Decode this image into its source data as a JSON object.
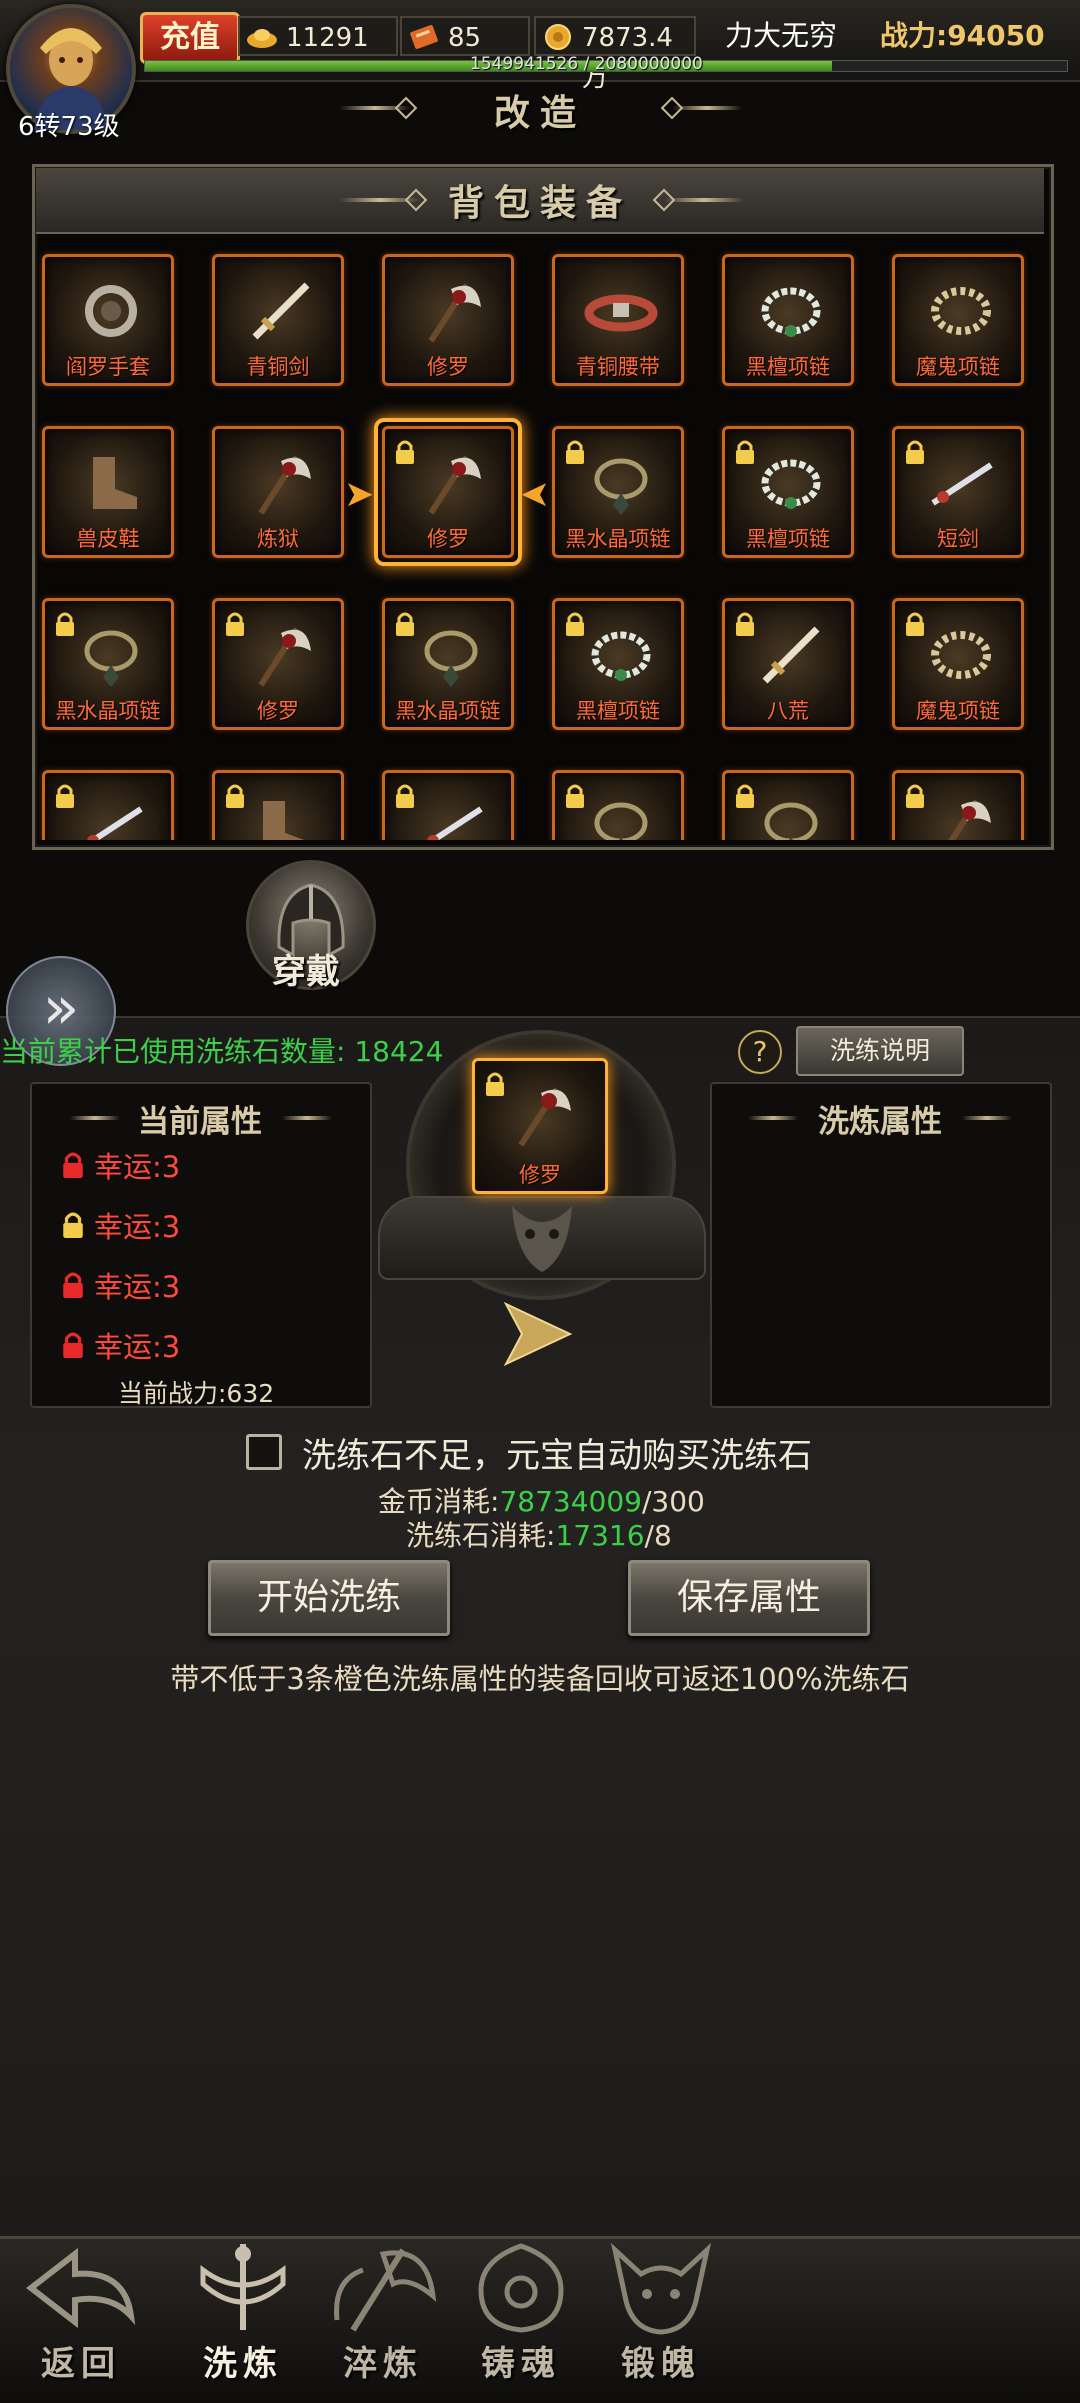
{
  "player": {
    "level": "6转73级",
    "recharge_label": "充值",
    "gold_ingot": "11291",
    "coupon": "85",
    "coins": "7873.4万",
    "vip_title": "力大无穷",
    "combat_power": "战力:94050",
    "exp_text": "1549941526 / 2080000000",
    "exp_fraction": 0.745
  },
  "page_title": "改造",
  "bag": {
    "title": "背包装备",
    "rows": [
      [
        {
          "name": "阎罗手套",
          "icon": "gloves",
          "locked": false
        },
        {
          "name": "青铜剑",
          "icon": "sword",
          "locked": false
        },
        {
          "name": "修罗",
          "icon": "axe",
          "locked": false
        },
        {
          "name": "青铜腰带",
          "icon": "belt",
          "locked": false
        },
        {
          "name": "黑檀项链",
          "icon": "pearl-necklace",
          "locked": false
        },
        {
          "name": "魔鬼项链",
          "icon": "skull-necklace",
          "locked": false
        }
      ],
      [
        {
          "name": "兽皮鞋",
          "icon": "boots",
          "locked": false
        },
        {
          "name": "炼狱",
          "icon": "axe",
          "locked": false
        },
        {
          "name": "修罗",
          "icon": "axe",
          "locked": true,
          "selected": true
        },
        {
          "name": "黑水晶项链",
          "icon": "crystal-necklace",
          "locked": true
        },
        {
          "name": "黑檀项链",
          "icon": "pearl-necklace",
          "locked": true
        },
        {
          "name": "短剑",
          "icon": "dagger",
          "locked": true
        }
      ],
      [
        {
          "name": "黑水晶项链",
          "icon": "crystal-necklace",
          "locked": true
        },
        {
          "name": "修罗",
          "icon": "axe",
          "locked": true
        },
        {
          "name": "黑水晶项链",
          "icon": "crystal-necklace",
          "locked": true
        },
        {
          "name": "黑檀项链",
          "icon": "pearl-necklace",
          "locked": true
        },
        {
          "name": "八荒",
          "icon": "sword",
          "locked": true
        },
        {
          "name": "魔鬼项链",
          "icon": "skull-necklace",
          "locked": true
        }
      ],
      [
        {
          "name": "",
          "icon": "dagger",
          "locked": true
        },
        {
          "name": "",
          "icon": "boots",
          "locked": true
        },
        {
          "name": "",
          "icon": "dagger",
          "locked": true
        },
        {
          "name": "",
          "icon": "crystal-necklace",
          "locked": true
        },
        {
          "name": "",
          "icon": "crystal-necklace",
          "locked": true
        },
        {
          "name": "",
          "icon": "axe",
          "locked": true
        }
      ]
    ]
  },
  "wear_label": "穿戴",
  "refine": {
    "used_stones_text": "当前累计已使用洗练石数量: 18424",
    "help_icon": "?",
    "explain_label": "洗练说明",
    "current_attr_title": "当前属性",
    "refined_attr_title": "洗炼属性",
    "current_attrs": [
      {
        "text": "幸运:3",
        "lock_color": "red"
      },
      {
        "text": "幸运:3",
        "lock_color": "gold"
      },
      {
        "text": "幸运:3",
        "lock_color": "red"
      },
      {
        "text": "幸运:3",
        "lock_color": "red"
      }
    ],
    "current_power": "当前战力:632",
    "item_name": "修罗",
    "auto_buy_text": "洗练石不足，元宝自动购买洗练石",
    "auto_buy_checked": false,
    "gold_cost_label": "金币消耗:",
    "gold_have": "78734009",
    "gold_need": "/300",
    "stone_cost_label": "洗练石消耗:",
    "stone_have": "17316",
    "stone_need": "/8",
    "start_label": "开始洗练",
    "save_label": "保存属性",
    "tip": "带不低于3条橙色洗练属性的装备回收可返还100%洗练石"
  },
  "nav": {
    "back": "返回",
    "refine": "洗炼",
    "temper": "淬炼",
    "cast_soul": "铸魂",
    "forge_soul": "锻魄"
  },
  "colors": {
    "slot_border": "#c9671e",
    "item_name": "#ff6a3a",
    "green_value": "#3cd04a",
    "selected_glow": "#ffb23a"
  }
}
